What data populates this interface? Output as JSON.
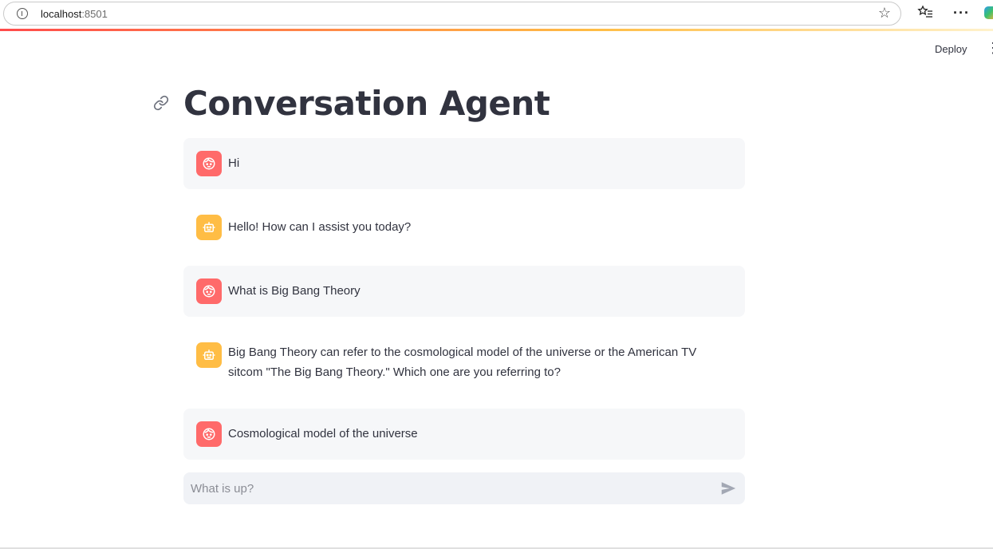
{
  "browser": {
    "url_host": "localhost",
    "url_port": ":8501",
    "icons": [
      "info-icon",
      "star-icon",
      "favorites-icon",
      "more-icon",
      "copilot-icon"
    ]
  },
  "app": {
    "deploy_label": "Deploy",
    "menu_symbol": "⋮",
    "title": "Conversation Agent"
  },
  "messages": [
    {
      "role": "user",
      "text": "Hi"
    },
    {
      "role": "assistant",
      "text": "Hello! How can I assist you today?"
    },
    {
      "role": "user",
      "text": "What is Big Bang Theory"
    },
    {
      "role": "assistant",
      "text": "Big Bang Theory can refer to the cosmological model of the universe or the American TV sitcom \"The Big Bang Theory.\" Which one are you referring to?"
    },
    {
      "role": "user",
      "text": "Cosmological model of the universe"
    }
  ],
  "chat_input": {
    "placeholder": "What is up?",
    "value": ""
  },
  "colors": {
    "user_avatar": "#ff6a6a",
    "bot_avatar": "#ffbd45",
    "user_bubble": "#f6f7f9",
    "input_bg": "#f0f2f6"
  }
}
